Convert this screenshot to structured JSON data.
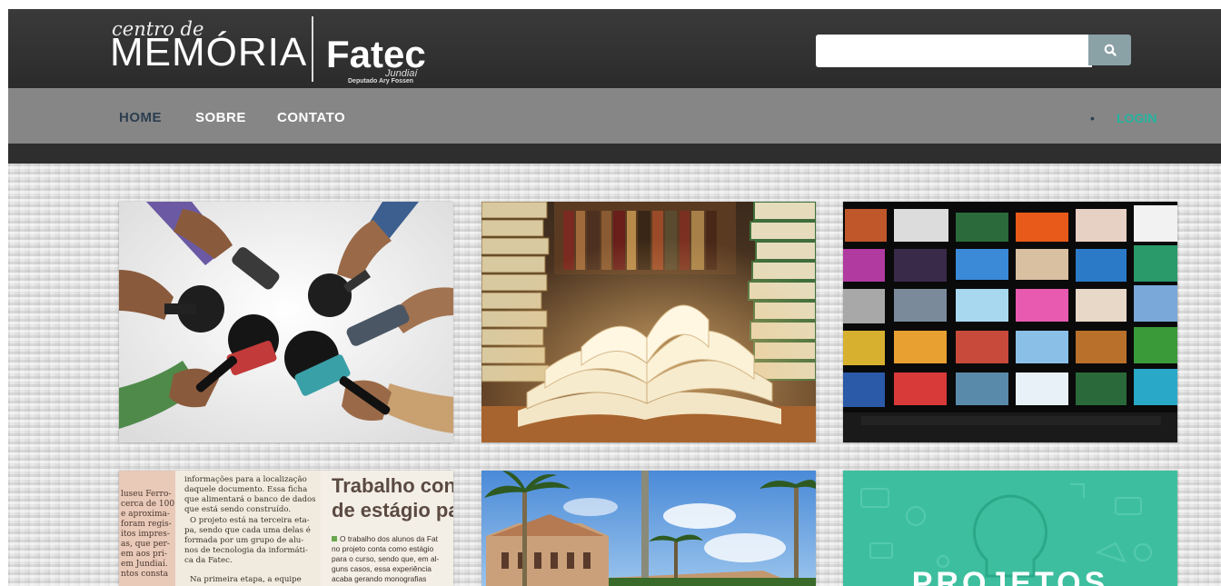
{
  "header": {
    "logo_small": "centro de",
    "logo_big": "MEMÓRIA",
    "logo_brand": "Fatec",
    "logo_city": "Jundiaí",
    "logo_sub": "Deputado Ary Fossen",
    "search_value": "",
    "search_icon": "search-icon"
  },
  "nav": {
    "items": [
      {
        "label": "HOME",
        "active": true
      },
      {
        "label": "SOBRE",
        "active": false
      },
      {
        "label": "CONTATO",
        "active": false
      }
    ],
    "bullet": "•",
    "login_label": "LOGIN"
  },
  "colors": {
    "topbar": "#2f2f2f",
    "navbar": "#868686",
    "active_nav": "#2c3e50",
    "login": "#23b6a0",
    "search_button": "#8aa1a6",
    "teal_tile": "#3dbf9f"
  },
  "tiles": [
    {
      "name": "microphones-press"
    },
    {
      "name": "open-book-library"
    },
    {
      "name": "media-screens-wall"
    },
    {
      "name": "newspaper-clipping",
      "col1_lines": [
        "luseu Ferro-",
        "cerca de 100",
        "e aproxima-",
        "foram regis-",
        "itos impres-",
        "as, que per-",
        "em aos pri-",
        "em Jundiaí.",
        "ntos consta"
      ],
      "col2_lines": [
        "informações para a localização",
        "daquele documento. Essa ficha",
        "que alimentará o banco de dados",
        "que está sendo construído.",
        "O projeto está na terceira eta-",
        "pa, sendo que cada uma delas é",
        "formada por um grupo de alu-",
        "nos de tecnologia da informáti-",
        "ca da Fatec.",
        "Na primeira etapa, a equipe"
      ],
      "headline_1": "Trabalho cont",
      "headline_2": "de estágio pa",
      "col3_lines": [
        "O trabalho dos alunos da Fat",
        "no projeto conta como estágio",
        "para o curso, sendo que, em al-",
        "guns casos, essa experiência",
        "acaba gerando monografias"
      ]
    },
    {
      "name": "historic-building"
    },
    {
      "name": "projects-teal",
      "label": "PROJETOS"
    }
  ]
}
